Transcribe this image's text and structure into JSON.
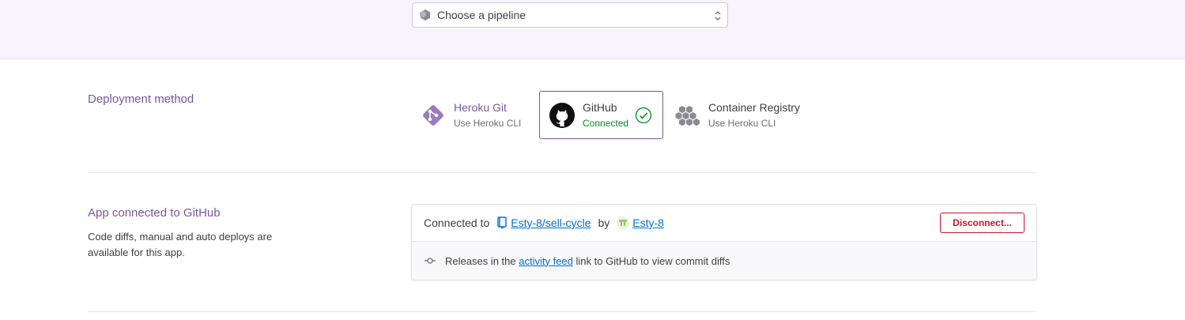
{
  "pipeline": {
    "placeholder": "Choose a pipeline",
    "icon": "pipeline-icon"
  },
  "deployment": {
    "title": "Deployment method",
    "methods": [
      {
        "name": "Heroku Git",
        "sub": "Use Heroku CLI",
        "icon": "heroku-git-icon"
      },
      {
        "name": "GitHub",
        "sub": "Connected",
        "icon": "github-icon",
        "selected": true
      },
      {
        "name": "Container Registry",
        "sub": "Use Heroku CLI",
        "icon": "container-registry-icon"
      }
    ]
  },
  "connection": {
    "title": "App connected to GitHub",
    "description": "Code diffs, manual and auto deploys are available for this app.",
    "connected_to_label": "Connected to",
    "repo": "Esty-8/sell-cycle",
    "by_label": "by",
    "user": "Esty-8",
    "disconnect_label": "Disconnect...",
    "releases_prefix": "Releases in the",
    "activity_feed_link": "activity feed",
    "releases_suffix": "link to GitHub to view commit diffs"
  },
  "colors": {
    "accent": "#79589f",
    "connected": "#008a23",
    "danger": "#c7162b",
    "link": "#0070d2"
  }
}
